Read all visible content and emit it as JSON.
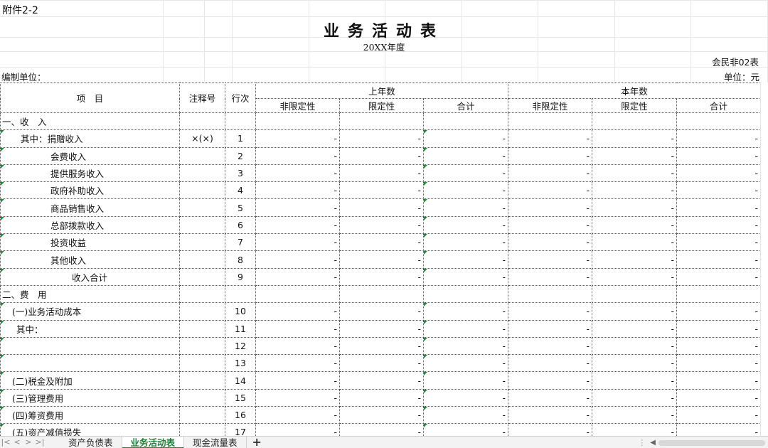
{
  "sheet": {
    "attachment_label": "附件2-2",
    "title": "业务活动表",
    "year": "20XX年度",
    "form_no": "会民非02表",
    "compiler_label": "编制单位：",
    "unit_label": "单位：元"
  },
  "table": {
    "headers": {
      "item": "项　目",
      "note": "注释号",
      "line": "行次",
      "last_year": "上年数",
      "this_year": "本年数",
      "unrestricted": "非限定性",
      "restricted": "限定性",
      "total": "合计"
    },
    "rows": [
      {
        "item": "一、收　入",
        "note": "",
        "line": "",
        "indent": "0",
        "values": false
      },
      {
        "item": "其中：捐赠收入",
        "note": "×(×)",
        "line": "1",
        "indent": "1",
        "values": true
      },
      {
        "item": "会费收入",
        "note": "",
        "line": "2",
        "indent": "2",
        "values": true
      },
      {
        "item": "提供服务收入",
        "note": "",
        "line": "3",
        "indent": "2",
        "values": true
      },
      {
        "item": "政府补助收入",
        "note": "",
        "line": "4",
        "indent": "2",
        "values": true
      },
      {
        "item": "商品销售收入",
        "note": "",
        "line": "5",
        "indent": "2",
        "values": true
      },
      {
        "item": "总部拨款收入",
        "note": "",
        "line": "6",
        "indent": "2",
        "values": true
      },
      {
        "item": "投资收益",
        "note": "",
        "line": "7",
        "indent": "2",
        "values": true
      },
      {
        "item": "其他收入",
        "note": "",
        "line": "8",
        "indent": "2",
        "values": true
      },
      {
        "item": "收入合计",
        "note": "",
        "line": "9",
        "indent": "3",
        "values": true
      },
      {
        "item": "二、费　用",
        "note": "",
        "line": "",
        "indent": "0",
        "values": false
      },
      {
        "item": "(一)业务活动成本",
        "note": "",
        "line": "10",
        "indent": "4",
        "values": true
      },
      {
        "item": "其中：",
        "note": "",
        "line": "11",
        "indent": "5",
        "values": true
      },
      {
        "item": "",
        "note": "",
        "line": "12",
        "indent": "0",
        "values": true
      },
      {
        "item": "",
        "note": "",
        "line": "13",
        "indent": "0",
        "values": true
      },
      {
        "item": "(二)税金及附加",
        "note": "",
        "line": "14",
        "indent": "4",
        "values": true
      },
      {
        "item": "(三)管理费用",
        "note": "",
        "line": "15",
        "indent": "4",
        "values": true
      },
      {
        "item": "(四)筹资费用",
        "note": "",
        "line": "16",
        "indent": "4",
        "values": true
      },
      {
        "item": "(五)资产减值损失",
        "note": "",
        "line": "17",
        "indent": "4",
        "values": true
      }
    ],
    "dash": "-"
  },
  "tabs": {
    "nav_first": "|<",
    "nav_prev": "<",
    "nav_next": ">",
    "nav_last": ">|",
    "items": [
      "资产负债表",
      "业务活动表",
      "现金流量表"
    ],
    "active_index": 1,
    "add": "+",
    "accent_color": "#1e7e34"
  }
}
